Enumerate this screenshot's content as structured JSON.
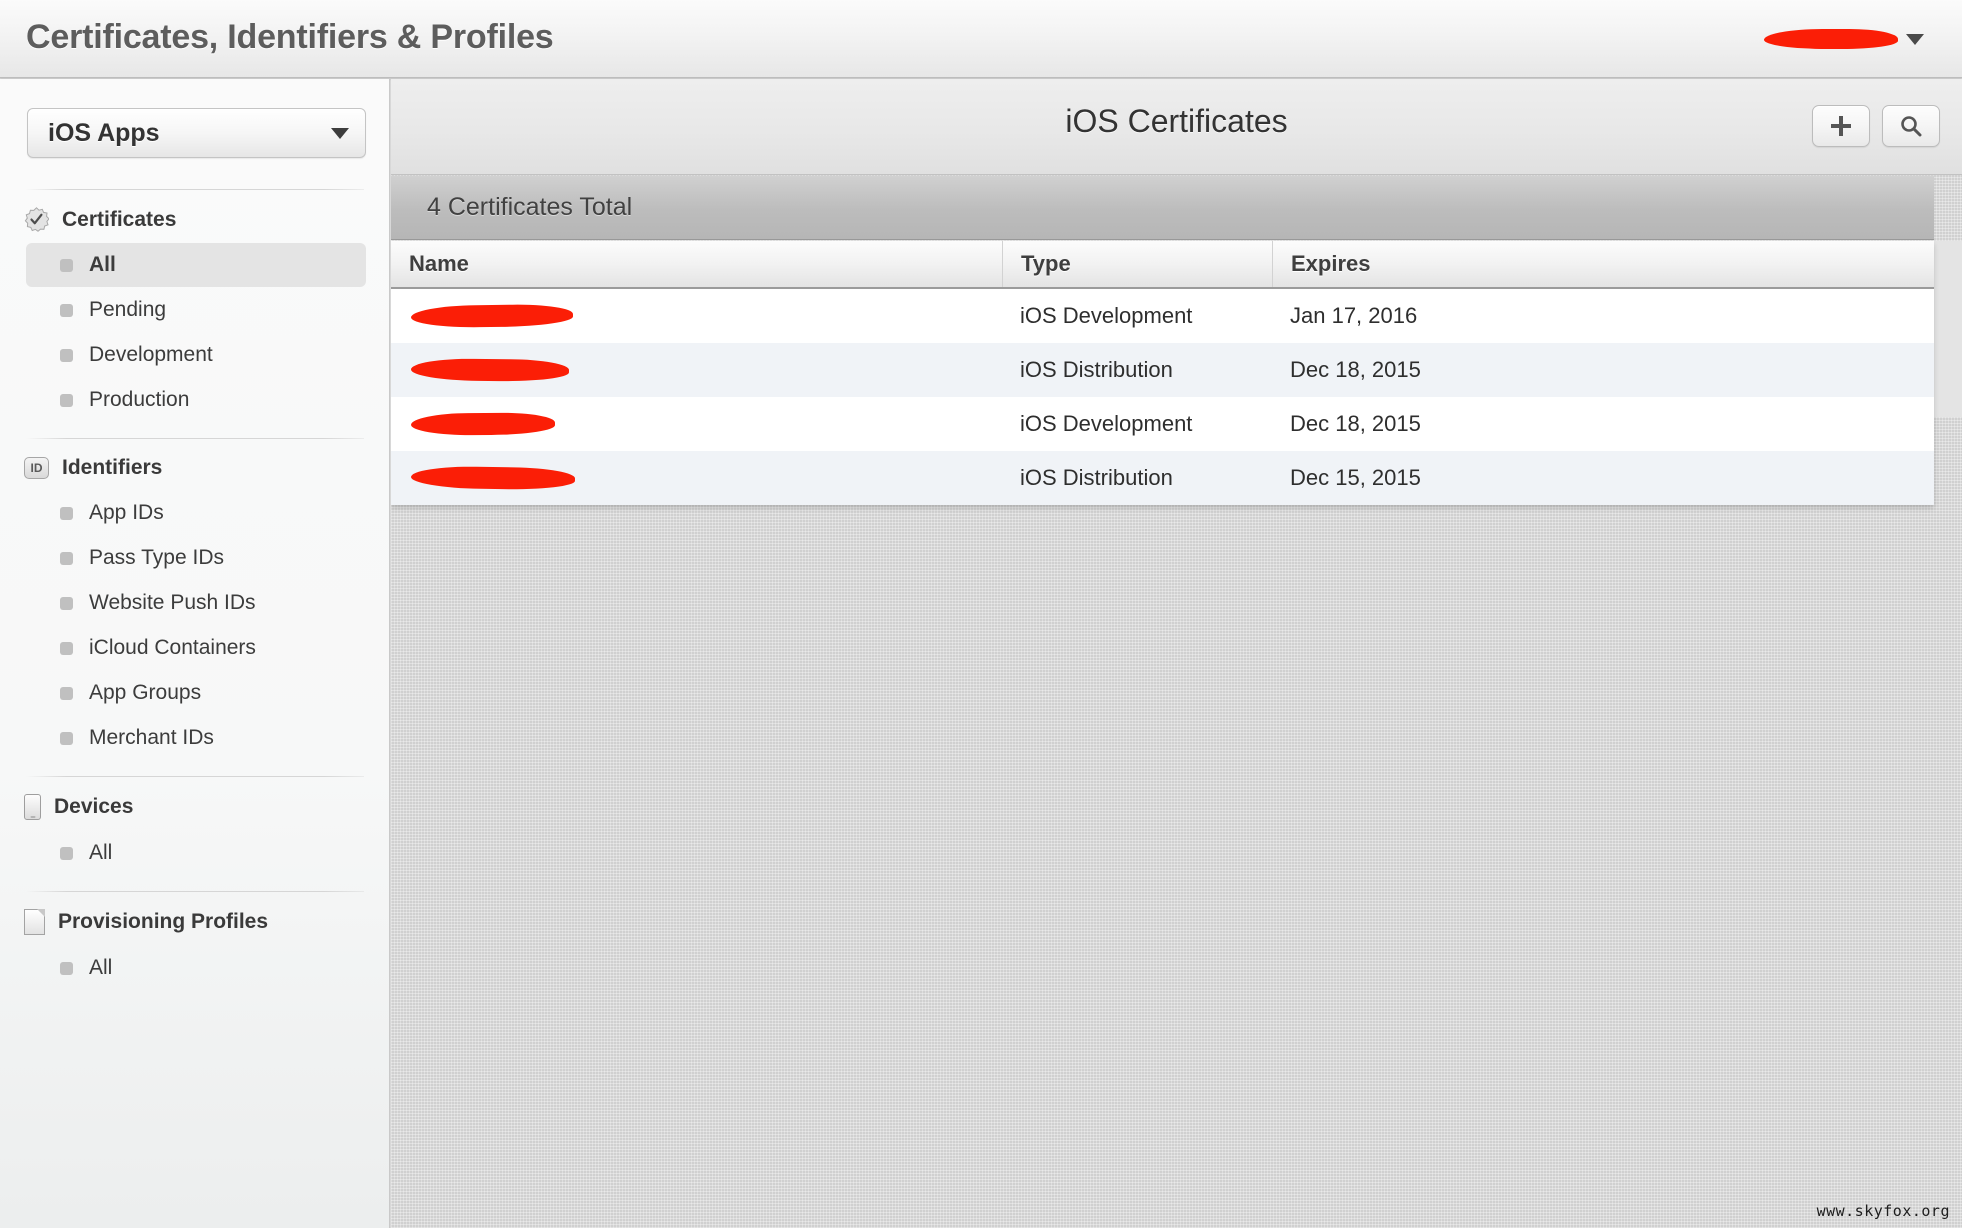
{
  "topbar": {
    "title": "Certificates, Identifiers & Profiles",
    "account_name_redacted": "",
    "account_caret_icon": "chevron-down-icon"
  },
  "sidebar": {
    "app_selector": {
      "selected": "iOS Apps",
      "caret_icon": "chevron-down-icon"
    },
    "sections": [
      {
        "label": "Certificates",
        "icon": "certificate-seal-icon",
        "items": [
          {
            "label": "All",
            "active": true
          },
          {
            "label": "Pending",
            "active": false
          },
          {
            "label": "Development",
            "active": false
          },
          {
            "label": "Production",
            "active": false
          }
        ]
      },
      {
        "label": "Identifiers",
        "icon": "id-badge-icon",
        "items": [
          {
            "label": "App IDs",
            "active": false
          },
          {
            "label": "Pass Type IDs",
            "active": false
          },
          {
            "label": "Website Push IDs",
            "active": false
          },
          {
            "label": "iCloud Containers",
            "active": false
          },
          {
            "label": "App Groups",
            "active": false
          },
          {
            "label": "Merchant IDs",
            "active": false
          }
        ]
      },
      {
        "label": "Devices",
        "icon": "device-icon",
        "items": [
          {
            "label": "All",
            "active": false
          }
        ]
      },
      {
        "label": "Provisioning Profiles",
        "icon": "document-icon",
        "items": [
          {
            "label": "All",
            "active": false
          }
        ]
      }
    ]
  },
  "content": {
    "title": "iOS Certificates",
    "add_button_icon": "plus-icon",
    "search_button_icon": "search-icon",
    "count_label": "4 Certificates Total",
    "table": {
      "columns": [
        "Name",
        "Type",
        "Expires"
      ],
      "rows": [
        {
          "name": "",
          "type": "iOS Development",
          "expires": "Jan 17, 2016"
        },
        {
          "name": "",
          "type": "iOS Distribution",
          "expires": "Dec 18, 2015"
        },
        {
          "name": "",
          "type": "iOS Development",
          "expires": "Dec 18, 2015"
        },
        {
          "name": "",
          "type": "iOS Distribution",
          "expires": "Dec 15, 2015"
        }
      ]
    }
  },
  "watermark": "www.skyfox.org",
  "colors": {
    "redaction": "#fb1e06",
    "row_alt": "#f0f3f7",
    "count_bar": "#bcbcbc"
  }
}
